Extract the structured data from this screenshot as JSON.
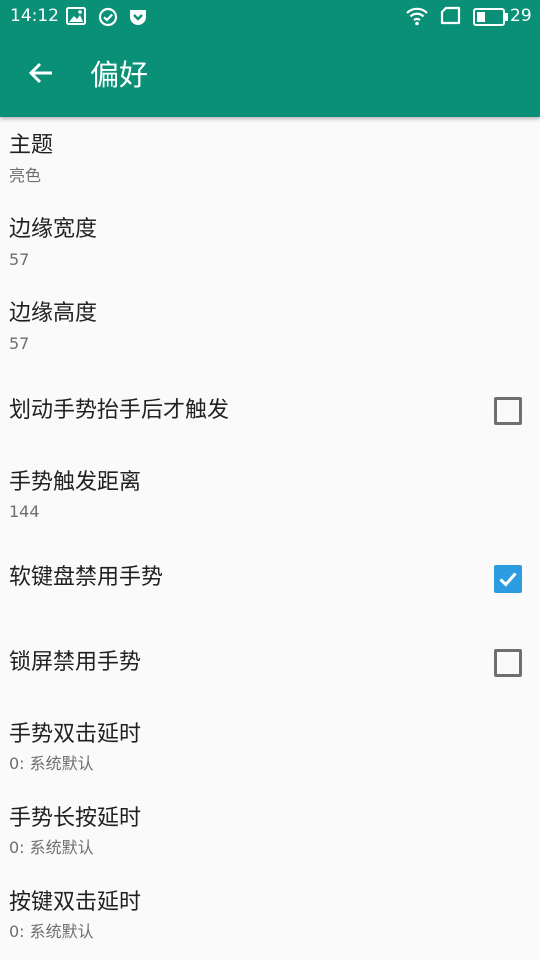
{
  "status_bar": {
    "time": "14:12",
    "battery_level": "29",
    "notification_icons": [
      "image-icon",
      "check-circle-icon",
      "pocket-icon"
    ],
    "system_icons": [
      "wifi-icon",
      "sim-icon",
      "battery-icon"
    ]
  },
  "appbar": {
    "title": "偏好",
    "back_icon": "arrow-left-icon",
    "color": "#0b9078"
  },
  "preferences": [
    {
      "title": "主题",
      "summary": "亮色"
    },
    {
      "title": "边缘宽度",
      "summary": "57"
    },
    {
      "title": "边缘高度",
      "summary": "57"
    },
    {
      "title": "划动手势抬手后才触发",
      "checked": false
    },
    {
      "title": "手势触发距离",
      "summary": "144"
    },
    {
      "title": "软键盘禁用手势",
      "checked": true
    },
    {
      "title": "锁屏禁用手势",
      "checked": false
    },
    {
      "title": "手势双击延时",
      "summary": "0: 系统默认"
    },
    {
      "title": "手势长按延时",
      "summary": "0: 系统默认"
    },
    {
      "title": "按键双击延时",
      "summary": "0: 系统默认"
    }
  ],
  "colors": {
    "checkbox_checked": "#2d9be0",
    "checkbox_unchecked": "#6f6f6f"
  }
}
